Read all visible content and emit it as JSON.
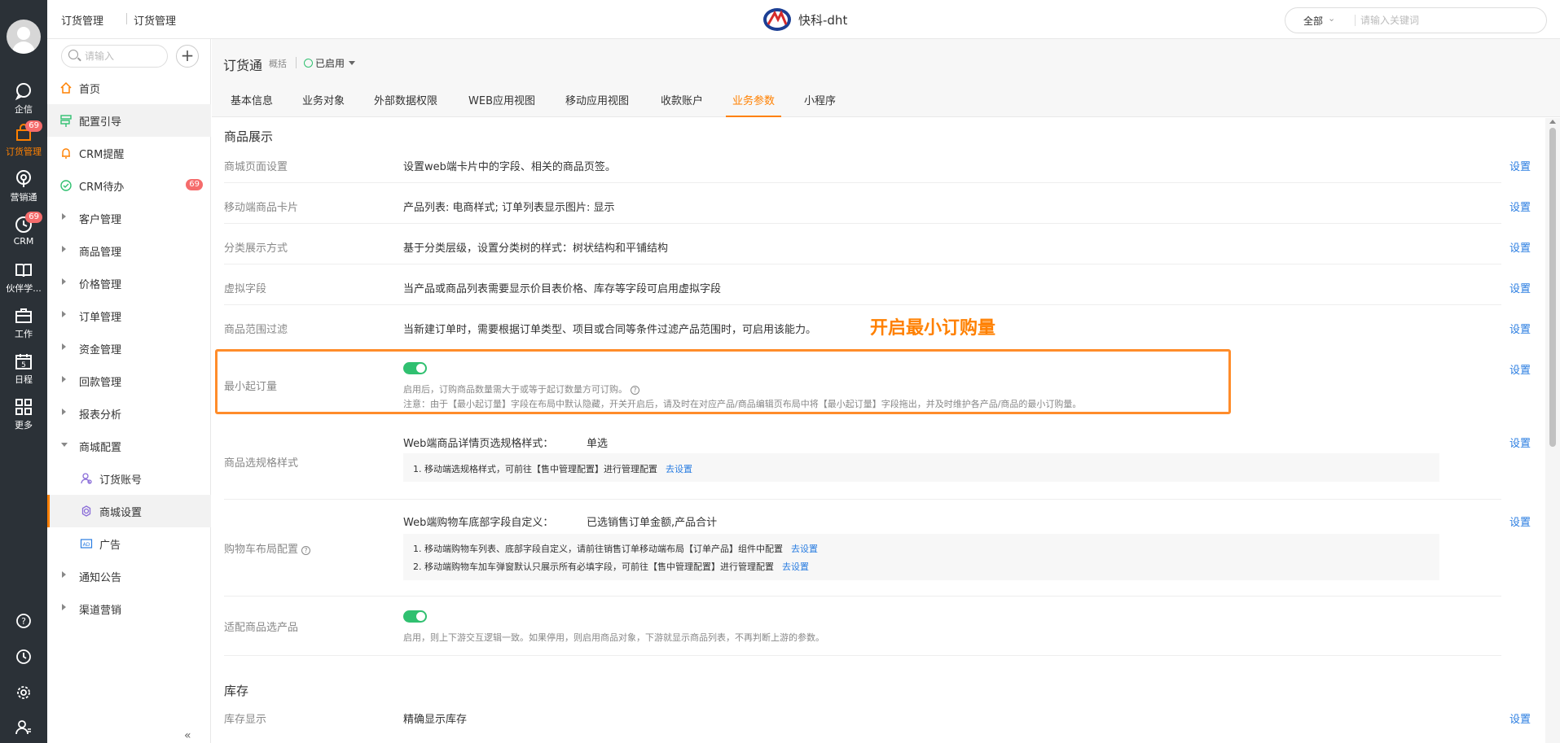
{
  "rail": {
    "items": [
      {
        "label": "企信",
        "icon": "chat-icon"
      },
      {
        "label": "订货管理",
        "icon": "cart-icon",
        "badge": "69",
        "active": true
      },
      {
        "label": "营销通",
        "icon": "broadcast-icon"
      },
      {
        "label": "CRM",
        "icon": "clock-icon",
        "badge": "69"
      },
      {
        "label": "伙伴学...",
        "icon": "book-icon"
      },
      {
        "label": "工作",
        "icon": "briefcase-icon"
      },
      {
        "label": "日程",
        "icon": "calendar-icon",
        "day": "5"
      },
      {
        "label": "更多",
        "icon": "grid-icon"
      }
    ],
    "bottom_icons": [
      "help-icon",
      "history-icon",
      "settings-icon",
      "user-settings-icon"
    ]
  },
  "topbar": {
    "crumb1": "订货管理",
    "crumb2": "订货管理",
    "brand": "快科-dht",
    "search_scope": "全部",
    "search_placeholder": "请输入关键词"
  },
  "sidebar": {
    "search_placeholder": "请输入",
    "items": [
      {
        "label": "首页",
        "icon": "home-icon"
      },
      {
        "label": "配置引导",
        "icon": "signpost-icon",
        "active": true
      },
      {
        "label": "CRM提醒",
        "icon": "bell-icon"
      },
      {
        "label": "CRM待办",
        "icon": "check-circle-icon",
        "count": "69"
      },
      {
        "label": "客户管理",
        "expandable": true
      },
      {
        "label": "商品管理",
        "expandable": true
      },
      {
        "label": "价格管理",
        "expandable": true
      },
      {
        "label": "订单管理",
        "expandable": true
      },
      {
        "label": "资金管理",
        "expandable": true
      },
      {
        "label": "回款管理",
        "expandable": true
      },
      {
        "label": "报表分析",
        "expandable": true
      },
      {
        "label": "商城配置",
        "expandable": true,
        "open": true
      },
      {
        "label": "订货账号",
        "icon": "account-icon",
        "child": true
      },
      {
        "label": "商城设置",
        "icon": "gear-icon",
        "child": true,
        "selected": true
      },
      {
        "label": "广告",
        "icon": "ad-icon",
        "child": true
      },
      {
        "label": "通知公告",
        "expandable": true
      },
      {
        "label": "渠道营销",
        "expandable": true
      }
    ],
    "collapse_glyph": "«"
  },
  "header": {
    "title": "订货通",
    "subtitle": "概括",
    "status": "已启用",
    "tabs": [
      "基本信息",
      "业务对象",
      "外部数据权限",
      "WEB应用视图",
      "移动应用视图",
      "收款账户",
      "业务参数",
      "小程序"
    ],
    "active_tab": "业务参数"
  },
  "content": {
    "section1_title": "商品展示",
    "set_label": "设置",
    "rows": [
      {
        "label": "商城页面设置",
        "text": "设置web端卡片中的字段、相关的商品页签。"
      },
      {
        "label": "移动端商品卡片",
        "text": "产品列表: 电商样式; 订单列表显示图片: 显示"
      },
      {
        "label": "分类展示方式",
        "text": "基于分类层级，设置分类树的样式：树状结构和平铺结构"
      },
      {
        "label": "虚拟字段",
        "text": "当产品或商品列表需要显示价目表价格、库存等字段可启用虚拟字段"
      },
      {
        "label": "商品范围过滤",
        "text": "当新建订单时，需要根据订单类型、项目或合同等条件过滤产品范围时，可启用该能力。"
      }
    ],
    "annotation": "开启最小订购量",
    "min_order": {
      "label": "最小起订量",
      "enabled": true,
      "desc": "启用后，订购商品数量需大于或等于起订数量方可订购。",
      "note": "注意：由于【最小起订量】字段在布局中默认隐藏，开关开启后，请及时在对应产品/商品编辑页布局中将【最小起订量】字段拖出，并及时维护各产品/商品的最小订购量。"
    },
    "spec": {
      "label": "商品选规格样式",
      "key": "Web端商品详情页选规格样式：",
      "value": "单选",
      "note": "1. 移动端选规格样式，可前往【售中管理配置】进行管理配置",
      "link": "去设置"
    },
    "cart": {
      "label": "购物车布局配置",
      "key": "Web端购物车底部字段自定义：",
      "value": "已选销售订单金额,产品合计",
      "note1": "1. 移动端购物车列表、底部字段自定义，请前往销售订单移动端布局【订单产品】组件中配置",
      "note2": "2. 移动端购物车加车弹窗默认只展示所有必填字段，可前往【售中管理配置】进行管理配置",
      "link": "去设置"
    },
    "adapt": {
      "label": "适配商品选产品",
      "enabled": true,
      "desc": "启用，则上下游交互逻辑一致。如果停用，则启用商品对象，下游就显示商品列表，不再判断上游的参数。"
    },
    "section2_title": "库存",
    "stock": {
      "label": "库存显示",
      "text": "精确显示库存"
    }
  },
  "colors": {
    "accent": "#ff8000",
    "link": "#2a7de1",
    "toggle_on": "#30c070",
    "badge": "#f56c6c",
    "rail_bg": "#2b3137"
  }
}
